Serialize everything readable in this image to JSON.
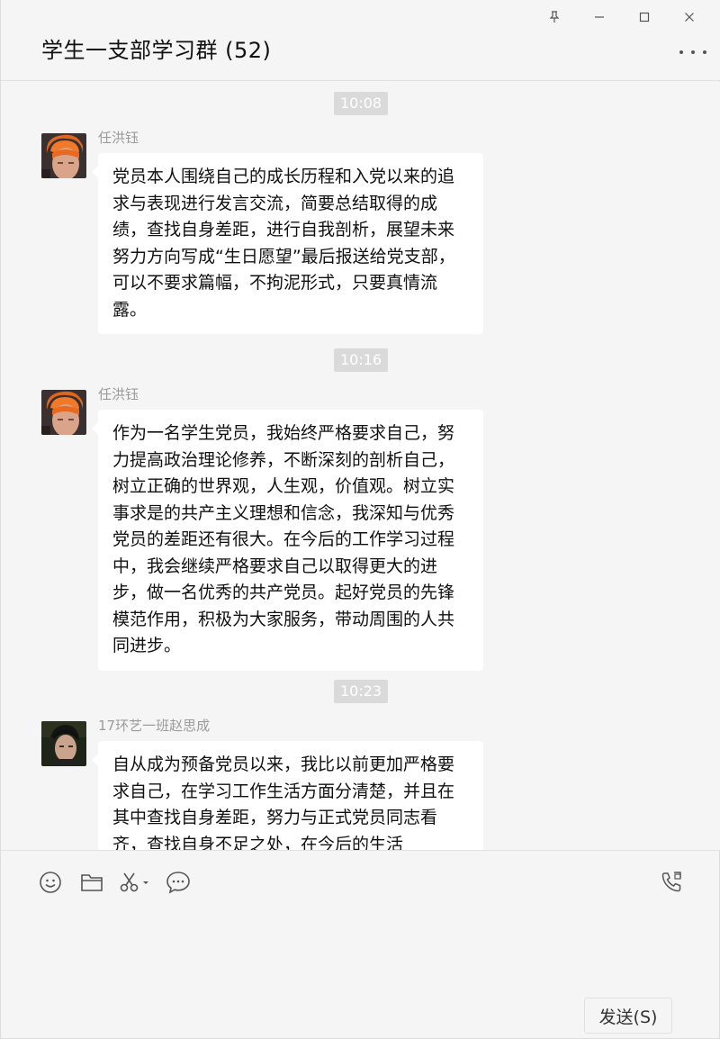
{
  "window": {
    "pin_icon": "pin-icon",
    "minimize_icon": "minimize-icon",
    "maximize_icon": "maximize-icon",
    "close_icon": "close-icon"
  },
  "header": {
    "title": "学生一支部学习群 (52)",
    "more_icon": "more-icon"
  },
  "messages": [
    {
      "time": "10:08",
      "sender": "任洪钰",
      "text": "党员本人围绕自己的成长历程和入党以来的追求与表现进行发言交流，简要总结取得的成绩，查找自身差距，进行自我剖析，展望未来努力方向写成“生日愿望”最后报送给党支部，可以不要求篇幅，不拘泥形式，只要真情流露。"
    },
    {
      "time": "10:16",
      "sender": "任洪钰",
      "text": "作为一名学生党员，我始终严格要求自己，努力提高政治理论修养，不断深刻的剖析自己，树立正确的世界观，人生观，价值观。树立实事求是的共产主义理想和信念，我深知与优秀党员的差距还有很大。在今后的工作学习过程中，我会继续严格要求自己以取得更大的进步，做一名优秀的共产党员。起好党员的先锋模范作用，积极为大家服务，带动周围的人共同进步。"
    },
    {
      "time": "10:23",
      "sender": "17环艺一班赵思成",
      "text": "自从成为预备党员以来，我比以前更加严格要求自己，在学习工作生活方面分清楚，并且在其中查找自身差距，努力与正式党员同志看齐，查找自身不足之处，在今后的生活"
    }
  ],
  "toolbar": {
    "emoji_icon": "emoji-icon",
    "folder_icon": "folder-icon",
    "scissors_icon": "scissors-icon",
    "chat_history_icon": "chat-history-icon",
    "voice_call_icon": "voice-call-icon"
  },
  "input": {
    "send_label": "发送(S)"
  },
  "colors": {
    "background": "#f5f5f5",
    "bubble": "#ffffff",
    "time_badge": "#dadada",
    "sender_text": "#9b9b9b"
  }
}
